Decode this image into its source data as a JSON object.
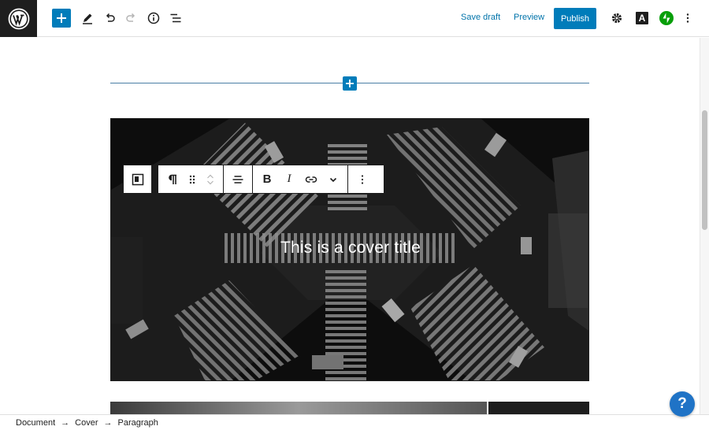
{
  "toolbar": {
    "save_draft": "Save draft",
    "preview": "Preview",
    "publish": "Publish",
    "avatar_letter": "A"
  },
  "cover": {
    "title": "This is a cover title"
  },
  "block_toolbar": {
    "bold": "B",
    "italic": "I"
  },
  "breadcrumb": [
    "Document",
    "Cover",
    "Paragraph"
  ],
  "help": {
    "label": "?"
  },
  "colors": {
    "accent": "#007cba",
    "dark": "#1e1e1e",
    "jetpack": "#069e08",
    "help": "#1f73c6"
  }
}
